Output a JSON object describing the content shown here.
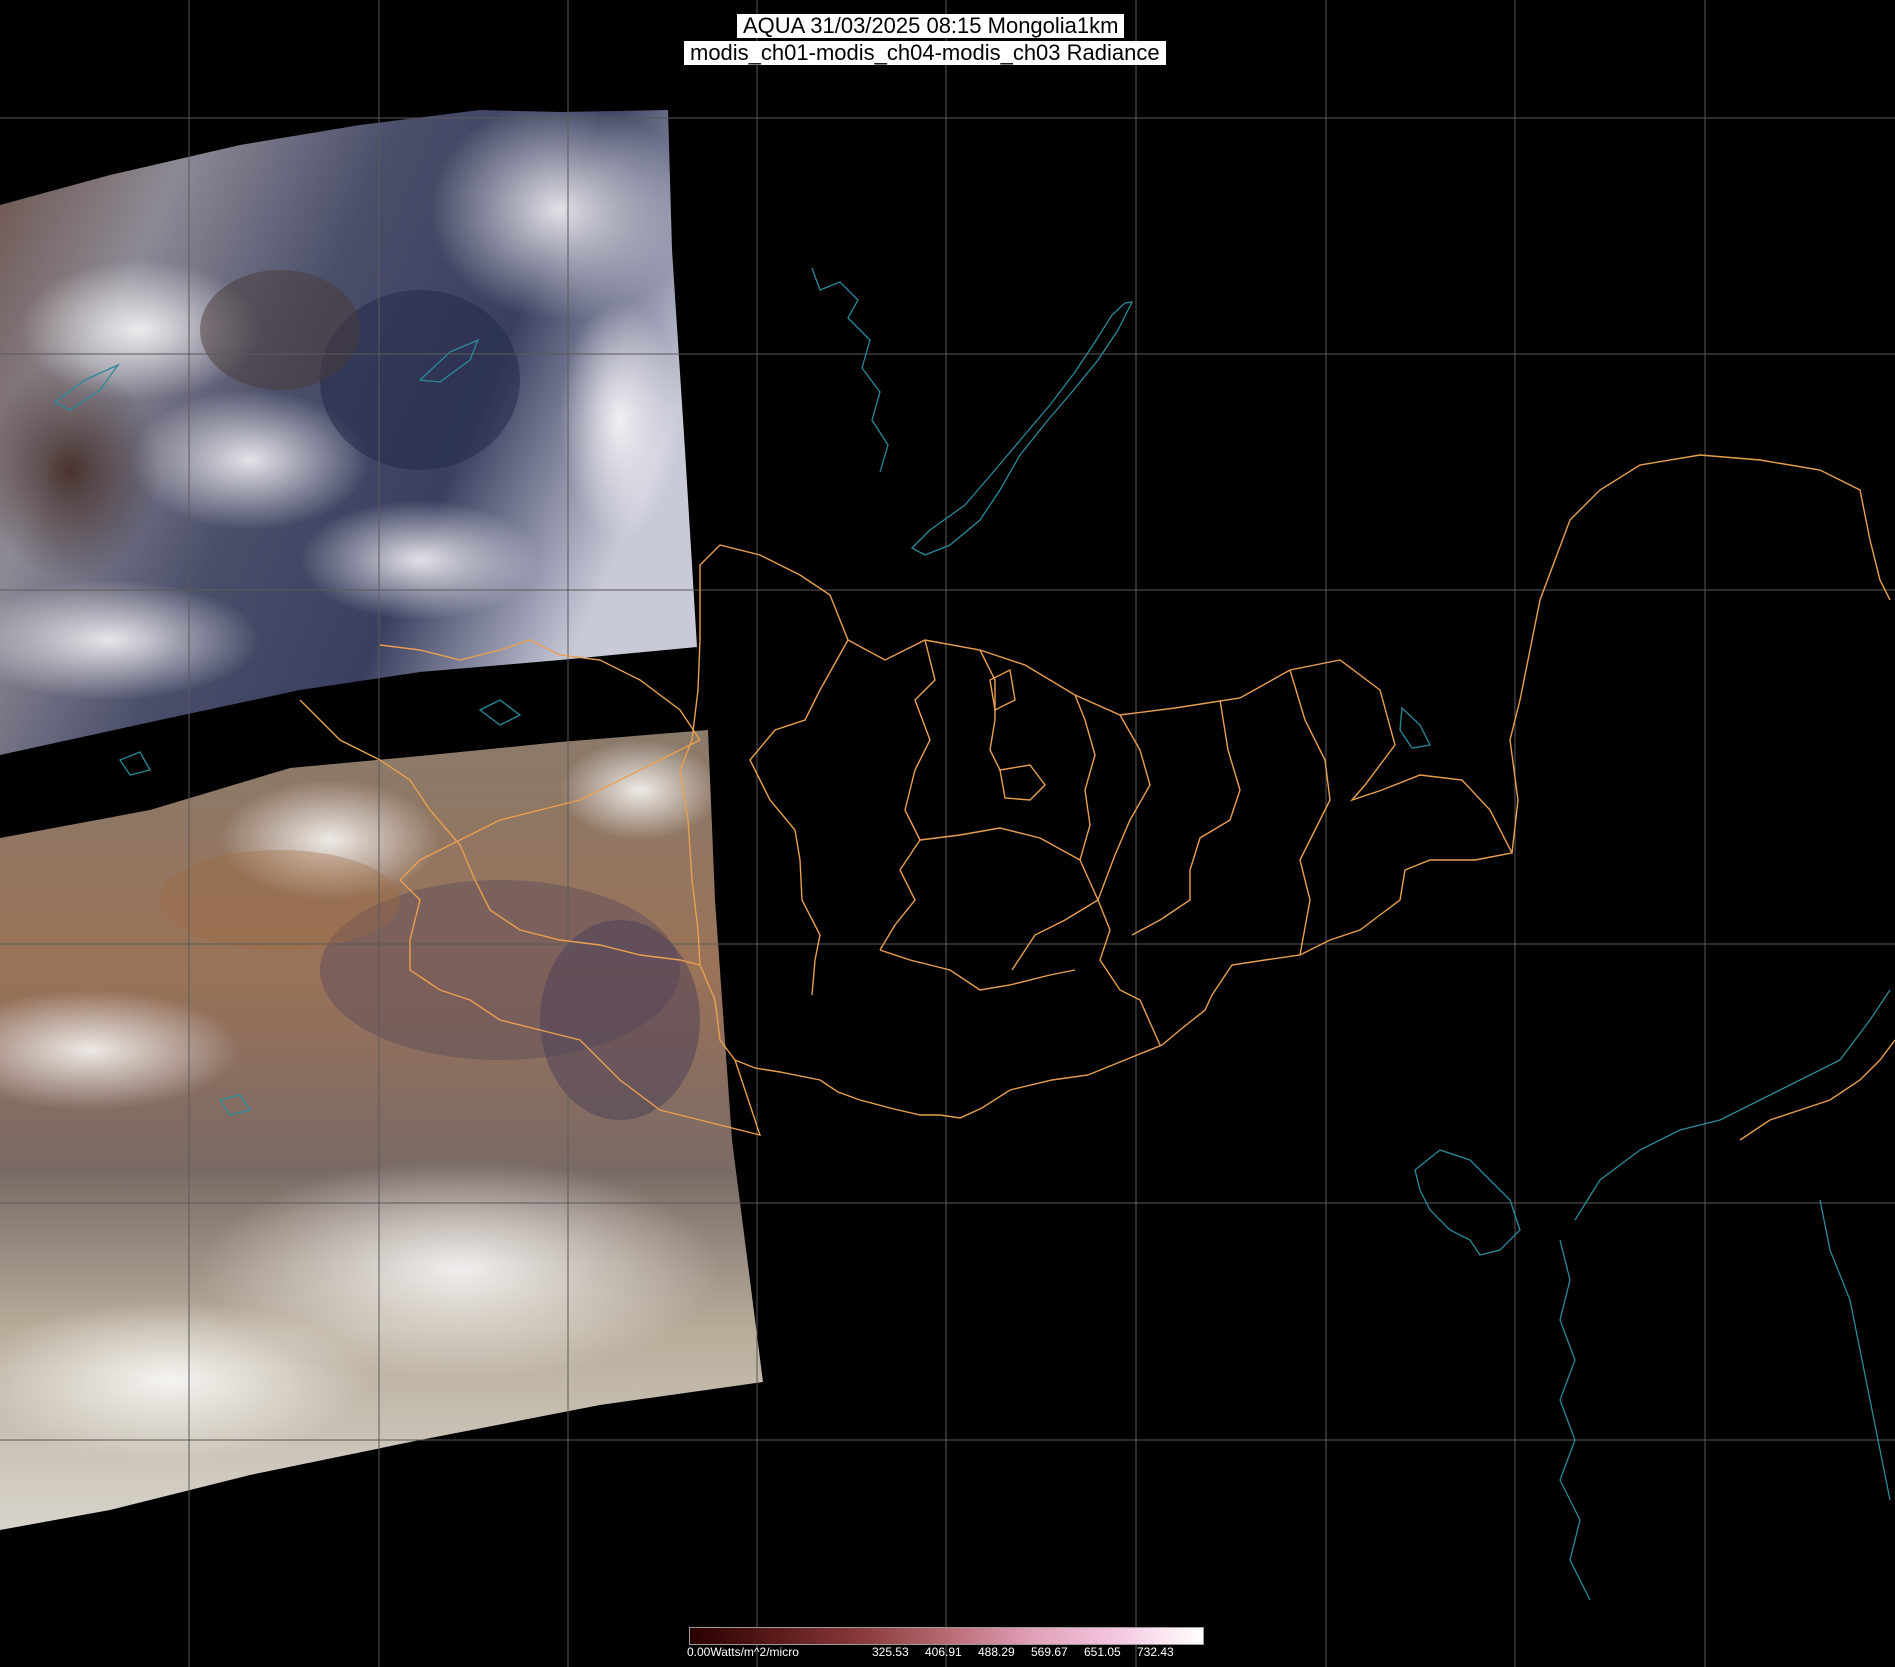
{
  "title": {
    "line1": "AQUA 31/03/2025 08:15 Mongolia1km",
    "line2": "modis_ch01-modis_ch04-modis_ch03 Radiance"
  },
  "colorbar": {
    "min_label": "0.00Watts/m^2/micro",
    "tick_labels": [
      "325.53",
      "406.91",
      "488.29",
      "569.67",
      "651.05",
      "732.43"
    ],
    "colors": [
      "#2a0000",
      "#5a1a1a",
      "#8a3a3a",
      "#b86a72",
      "#e0a0b8",
      "#f4c8e0",
      "#ffffff"
    ]
  },
  "map": {
    "background_color": "#000000",
    "gridline_color": "#5a5a5a",
    "border_color": "#e8a050",
    "coastline_color": "#2a8a9a",
    "layers": [
      "satellite-swath-north",
      "satellite-swath-south",
      "lat-lon-grid",
      "province-borders",
      "coastlines-lakes"
    ]
  }
}
